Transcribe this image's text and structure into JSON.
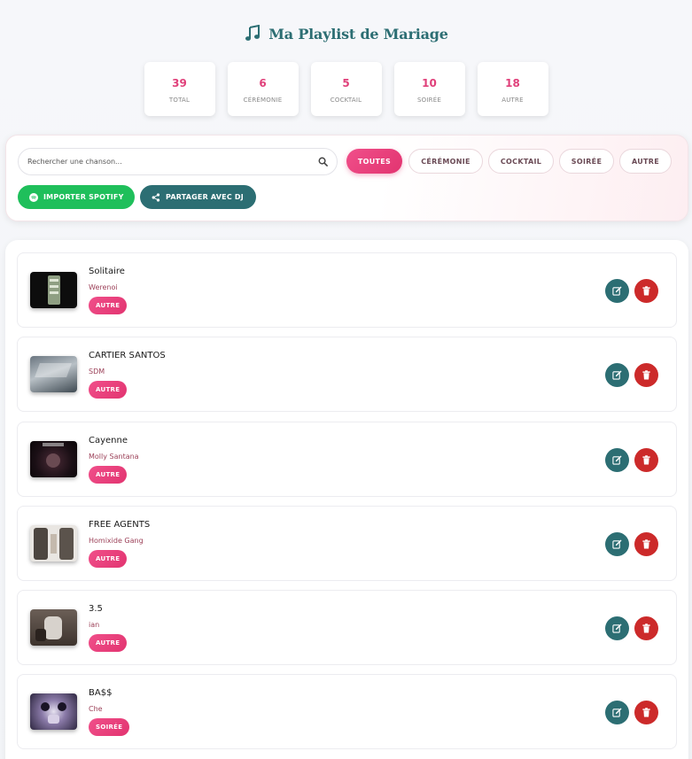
{
  "header": {
    "title": "Ma Playlist de Mariage",
    "icon": "music-note-icon"
  },
  "stats": [
    {
      "value": "39",
      "label": "TOTAL"
    },
    {
      "value": "6",
      "label": "CÉRÉMONIE"
    },
    {
      "value": "5",
      "label": "COCKTAIL"
    },
    {
      "value": "10",
      "label": "SOIRÉE"
    },
    {
      "value": "18",
      "label": "AUTRE"
    }
  ],
  "search": {
    "placeholder": "Rechercher une chanson...",
    "value": ""
  },
  "filters": [
    {
      "label": "TOUTES",
      "active": true
    },
    {
      "label": "CÉRÉMONIE",
      "active": false
    },
    {
      "label": "COCKTAIL",
      "active": false
    },
    {
      "label": "SOIRÉE",
      "active": false
    },
    {
      "label": "AUTRE",
      "active": false
    }
  ],
  "actions": {
    "spotify_label": "IMPORTER SPOTIFY",
    "share_label": "PARTAGER AVEC DJ"
  },
  "songs": [
    {
      "title": "Solitaire",
      "artist": "Werenoi",
      "category": "AUTRE"
    },
    {
      "title": "CARTIER SANTOS",
      "artist": "SDM",
      "category": "AUTRE"
    },
    {
      "title": "Cayenne",
      "artist": "Molly Santana",
      "category": "AUTRE"
    },
    {
      "title": "FREE AGENTS",
      "artist": "Homixide Gang",
      "category": "AUTRE"
    },
    {
      "title": "3.5",
      "artist": "ian",
      "category": "AUTRE"
    },
    {
      "title": "BA$$",
      "artist": "Che",
      "category": "SOIRÉE"
    }
  ],
  "colors": {
    "accent": "#e23470",
    "teal": "#2c6e73",
    "spotify": "#1fbf5b",
    "delete": "#cc2a2a"
  }
}
